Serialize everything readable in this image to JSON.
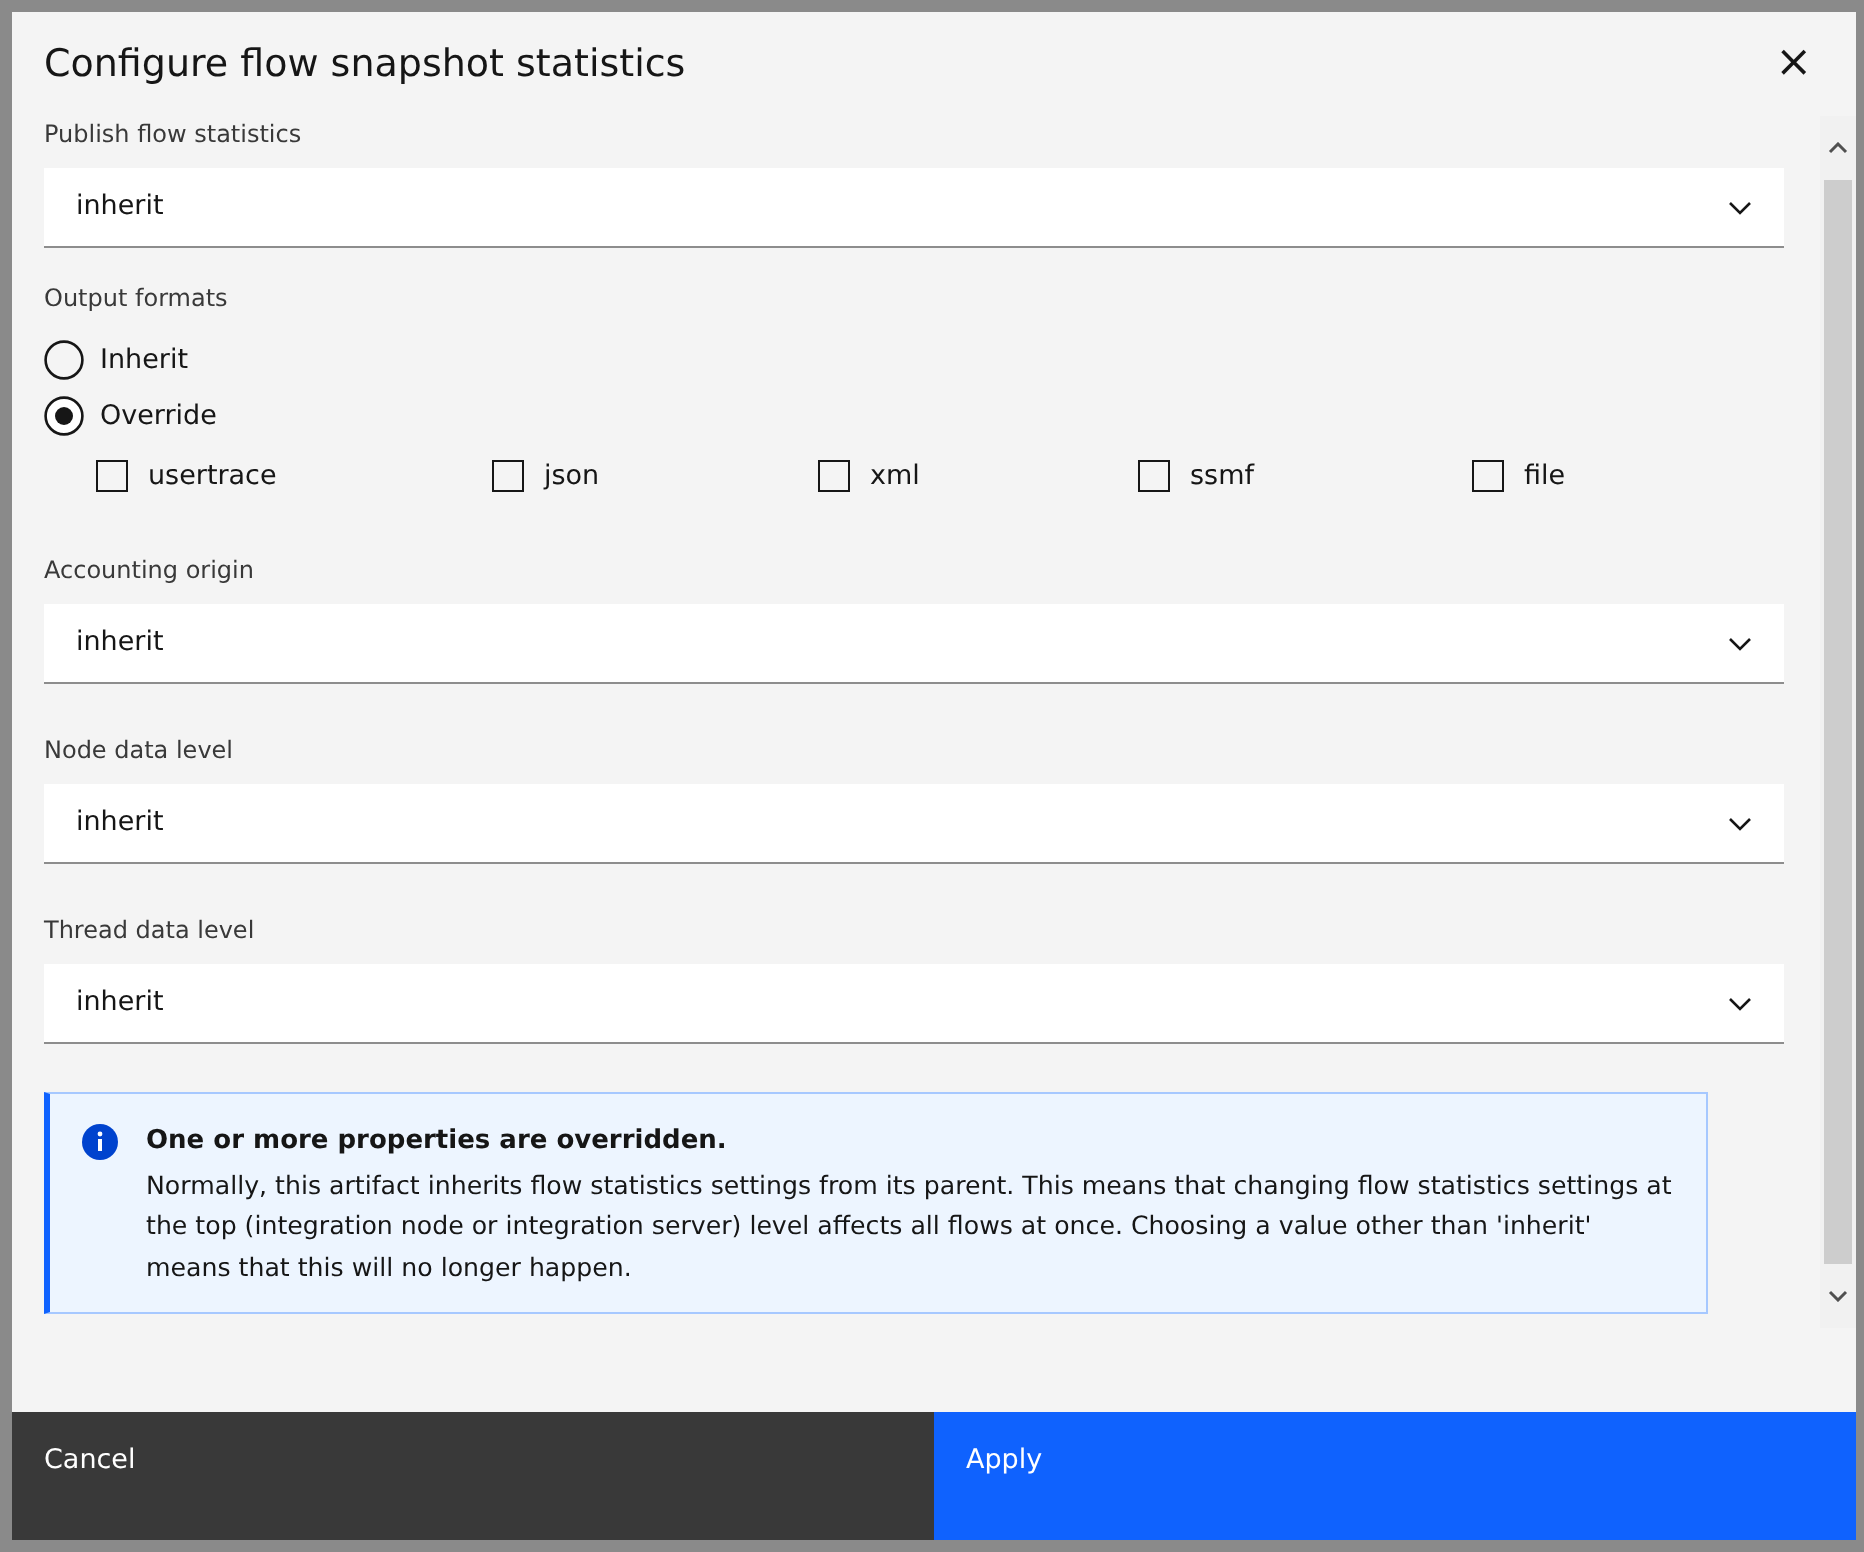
{
  "dialog": {
    "title": "Configure flow snapshot statistics",
    "close": "×"
  },
  "publish": {
    "label": "Publish flow statistics",
    "value": "inherit"
  },
  "output_formats": {
    "label": "Output formats",
    "options": [
      {
        "label": "Inherit",
        "selected": false
      },
      {
        "label": "Override",
        "selected": true
      }
    ],
    "formats": [
      {
        "label": "usertrace",
        "checked": false
      },
      {
        "label": "json",
        "checked": false
      },
      {
        "label": "xml",
        "checked": false
      },
      {
        "label": "ssmf",
        "checked": false
      },
      {
        "label": "file",
        "checked": false
      }
    ]
  },
  "selects": [
    {
      "label": "Accounting origin",
      "value": "inherit"
    },
    {
      "label": "Node data level",
      "value": "inherit"
    },
    {
      "label": "Thread data level",
      "value": "inherit"
    }
  ],
  "notice": {
    "title": "One or more properties are overridden.",
    "text": "Normally, this artifact inherits flow statistics settings from its parent. This means that changing flow statistics settings at the top (integration node or integration server) level affects all flows at once. Choosing a value other than 'inherit' means that this will no longer happen."
  },
  "buttons": [
    {
      "label": "Cancel",
      "kind": "secondary"
    },
    {
      "label": "Apply",
      "kind": "primary"
    }
  ]
}
